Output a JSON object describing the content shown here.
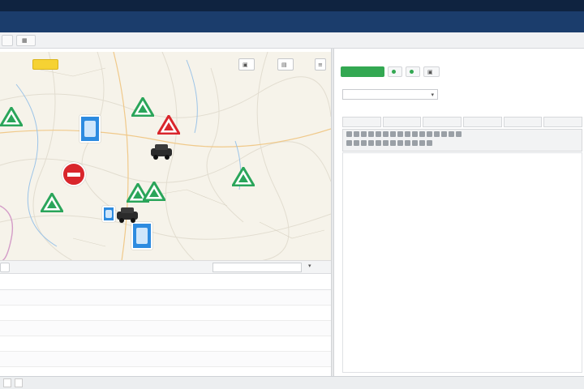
{
  "topbar": {
    "menu": [
      "",
      "",
      "",
      "",
      "",
      ""
    ]
  },
  "tabs": [
    {
      "label": ""
    },
    {
      "label": ""
    }
  ],
  "map": {
    "badge": "",
    "buttons": [
      {
        "label": ""
      },
      {
        "label": ""
      }
    ],
    "attribution": ""
  },
  "grid": {
    "toolbar_button": "",
    "filter_value": "",
    "columns": {
      "request": "",
      "date": "",
      "status": "",
      "num": ""
    },
    "rows": [
      {
        "name": "",
        "email": "",
        "date": "",
        "status": "",
        "num": ""
      },
      {
        "name": "",
        "email": "",
        "date": "",
        "status": "",
        "num": ""
      },
      {
        "name": "",
        "email": "",
        "date": "",
        "status": "",
        "num": ""
      },
      {
        "name": "",
        "email": "",
        "date": "",
        "status": "",
        "num": ""
      },
      {
        "name": "",
        "email": "",
        "date": "",
        "status": "",
        "num": ""
      }
    ]
  },
  "panel": {
    "title": "",
    "save_label": "",
    "links": [
      {
        "label": ""
      },
      {
        "label": ""
      },
      {
        "label": ""
      }
    ],
    "field_label_1": "",
    "field_value_1": "",
    "field_label_2": "",
    "editor_tabs": [
      "",
      "",
      "",
      "",
      "",
      ""
    ]
  },
  "statusbar": {
    "items": [
      "",
      ""
    ]
  },
  "colors": {
    "topbar": "#0f2340",
    "banner": "#1b3d6c",
    "accent_green": "#33a852",
    "marker_red": "#d9262c",
    "marker_blue": "#2d8be0",
    "badge_yellow": "#f6d233",
    "link_blue": "#2b6fc2"
  },
  "icons": [
    "warning-triangle-icon",
    "no-entry-icon",
    "info-sign-icon",
    "car-icon",
    "print-icon",
    "layers-icon",
    "dropdown-caret-icon"
  ]
}
